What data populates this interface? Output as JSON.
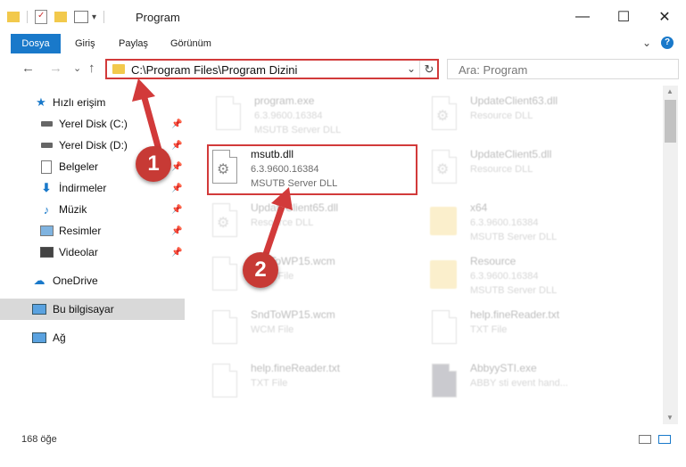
{
  "window": {
    "title": "Program",
    "minimize": "—",
    "maximize": "☐",
    "close": "✕"
  },
  "ribbon": {
    "tabs": [
      "Dosya",
      "Giriş",
      "Paylaş",
      "Görünüm"
    ],
    "help": "?",
    "expand": "⌄"
  },
  "navigation": {
    "back": "←",
    "forward": "→",
    "recent": "⌄",
    "up": "↑",
    "address": "C:\\Program Files\\Program Dizini",
    "search_placeholder": "Ara: Program"
  },
  "sidebar": {
    "quick_access": "Hızlı erişim",
    "items": [
      {
        "label": "Yerel Disk (C:)",
        "icon": "drive-icon",
        "pinned": true
      },
      {
        "label": "Yerel Disk (D:)",
        "icon": "drive-icon",
        "pinned": true
      },
      {
        "label": "Belgeler",
        "icon": "documents-icon",
        "pinned": true
      },
      {
        "label": "İndirmeler",
        "icon": "downloads-icon",
        "pinned": true
      },
      {
        "label": "Müzik",
        "icon": "music-icon",
        "pinned": true
      },
      {
        "label": "Resimler",
        "icon": "pictures-icon",
        "pinned": true
      },
      {
        "label": "Videolar",
        "icon": "videos-icon",
        "pinned": true
      }
    ],
    "onedrive": "OneDrive",
    "this_pc": "Bu bilgisayar",
    "network": "Ağ"
  },
  "files": [
    {
      "name": "program.exe",
      "line2": "6.3.9600.16384",
      "line3": "MSUTB Server DLL",
      "icon": "exe-icon"
    },
    {
      "name": "UpdateClient63.dll",
      "line2": "Resource DLL",
      "line3": "",
      "icon": "dll-icon"
    },
    {
      "name": "msutb.dll",
      "line2": "6.3.9600.16384",
      "line3": "MSUTB Server DLL",
      "icon": "dll-gear-icon"
    },
    {
      "name": "UpdateClient5.dll",
      "line2": "Resource DLL",
      "line3": "",
      "icon": "dll-icon"
    },
    {
      "name": "UpdateClient65.dll",
      "line2": "Resource DLL",
      "line3": "",
      "icon": "dll-icon"
    },
    {
      "name": "x64",
      "line2": "6.3.9600.16384",
      "line3": "MSUTB Server DLL",
      "icon": "folder-icon"
    },
    {
      "name": "SndToWP15.wcm",
      "line2": "WCM File",
      "line3": "",
      "icon": "file-icon"
    },
    {
      "name": "Resource",
      "line2": "6.3.9600.16384",
      "line3": "MSUTB Server DLL",
      "icon": "folder-icon"
    },
    {
      "name": "SndToWP15.wcm",
      "line2": "WCM File",
      "line3": "",
      "icon": "file-icon"
    },
    {
      "name": "help.fineReader.txt",
      "line2": "TXT File",
      "line3": "",
      "icon": "file-icon"
    },
    {
      "name": "help.fineReader.txt",
      "line2": "TXT File",
      "line3": "",
      "icon": "file-icon"
    },
    {
      "name": "AbbyySTI.exe",
      "line2": "ABBY sti event hand...",
      "line3": "",
      "icon": "exe-icon"
    }
  ],
  "status": {
    "count": "168 öğe"
  },
  "callouts": [
    "1",
    "2"
  ],
  "colors": {
    "accent": "#1979ca",
    "highlight_border": "#d23a3a",
    "callout": "#c73a35"
  }
}
